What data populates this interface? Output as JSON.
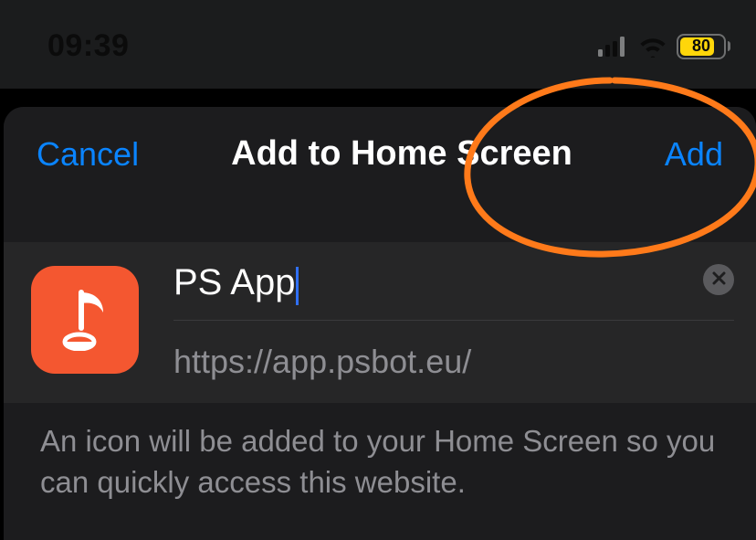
{
  "statusbar": {
    "time": "09:39",
    "battery_pct": 80
  },
  "navbar": {
    "cancel": "Cancel",
    "title": "Add to Home Screen",
    "add": "Add"
  },
  "form": {
    "app_name": "PS App",
    "url": "https://app.psbot.eu/"
  },
  "description": "An icon will be added to your Home Screen so you can quickly access this website.",
  "icons": {
    "cellular": "cellular-icon",
    "wifi": "wifi-icon",
    "clear": "xmark-icon",
    "app_glyph": "music-note-icon"
  },
  "colors": {
    "accent": "#0a84ff",
    "app_icon_bg": "#f45730",
    "battery_fill": "#ffd60a"
  }
}
